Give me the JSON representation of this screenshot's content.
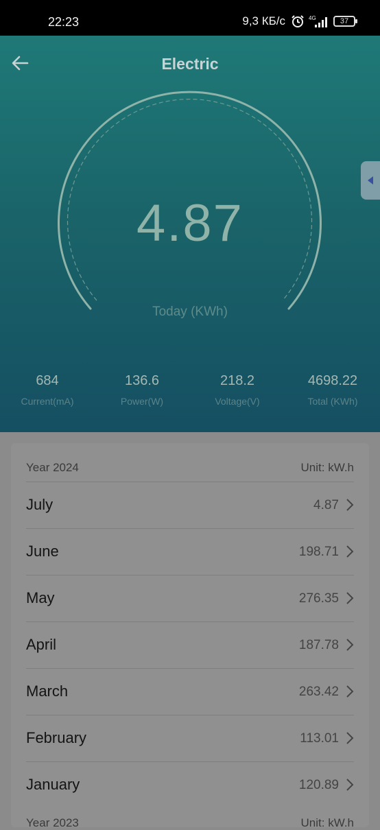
{
  "status_bar": {
    "time": "22:23",
    "net_speed": "9,3 КБ/с",
    "network_type": "4G",
    "battery": "37",
    "icons": [
      "alarm-icon",
      "signal-icon",
      "battery-icon"
    ]
  },
  "header": {
    "title": "Electric",
    "back_icon": "arrow-left-icon"
  },
  "gauge": {
    "value": "4.87",
    "label": "Today (KWh)"
  },
  "stats": [
    {
      "value": "684",
      "label": "Current(mA)"
    },
    {
      "value": "136.6",
      "label": "Power(W)"
    },
    {
      "value": "218.2",
      "label": "Voltage(V)"
    },
    {
      "value": "4698.22",
      "label": "Total (KWh)"
    }
  ],
  "history": {
    "year_label": "Year 2024",
    "unit_label": "Unit: kW.h",
    "months": [
      {
        "name": "July",
        "value": "4.87"
      },
      {
        "name": "June",
        "value": "198.71"
      },
      {
        "name": "May",
        "value": "276.35"
      },
      {
        "name": "April",
        "value": "187.78"
      },
      {
        "name": "March",
        "value": "263.42"
      },
      {
        "name": "February",
        "value": "113.01"
      },
      {
        "name": "January",
        "value": "120.89"
      }
    ],
    "next_year_label": "Year 2023",
    "next_unit_label": "Unit: kW.h"
  },
  "colors": {
    "hero_top": "#1f7977",
    "hero_bottom": "#154f62",
    "overlay_gray": "#8b8b8b"
  }
}
